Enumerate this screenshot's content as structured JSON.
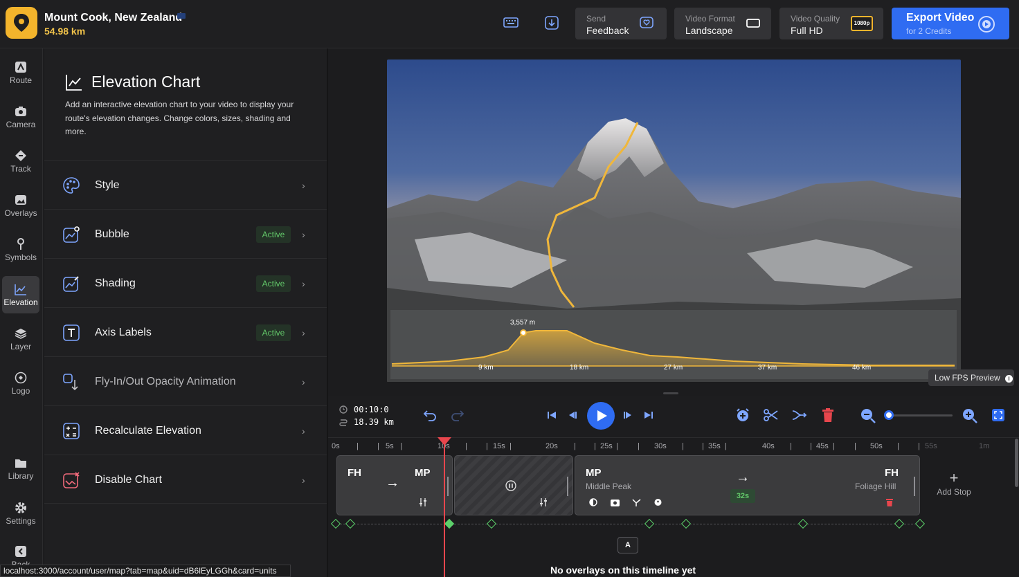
{
  "header": {
    "title": "Mount Cook, New Zealand",
    "distance": "54.98 km",
    "feedback": {
      "line1": "Send",
      "line2": "Feedback"
    },
    "format": {
      "line1": "Video Format",
      "line2": "Landscape"
    },
    "quality": {
      "line1": "Video Quality",
      "line2": "Full HD",
      "badge": "1080p"
    },
    "export": {
      "line1": "Export Video",
      "line2": "for 2 Credits"
    }
  },
  "nav": {
    "items": [
      {
        "label": "Route",
        "icon": "route-icon"
      },
      {
        "label": "Camera",
        "icon": "camera-icon"
      },
      {
        "label": "Track",
        "icon": "track-icon"
      },
      {
        "label": "Overlays",
        "icon": "overlays-icon"
      },
      {
        "label": "Symbols",
        "icon": "pin-icon"
      },
      {
        "label": "Elevation",
        "icon": "elevation-icon"
      },
      {
        "label": "Layer",
        "icon": "layers-icon"
      },
      {
        "label": "Logo",
        "icon": "logo-icon"
      },
      {
        "label": "Library",
        "icon": "folder-icon"
      },
      {
        "label": "Settings",
        "icon": "gear-icon"
      },
      {
        "label": "Back",
        "icon": "back-icon"
      }
    ]
  },
  "panel": {
    "title": "Elevation Chart",
    "description": "Add an interactive elevation chart to your video to display your route's elevation changes. Change colors, sizes, shading and more.",
    "rows": [
      {
        "label": "Style",
        "badge": "",
        "icon": "palette-icon"
      },
      {
        "label": "Bubble",
        "badge": "Active",
        "icon": "bubble-icon"
      },
      {
        "label": "Shading",
        "badge": "Active",
        "icon": "shading-icon"
      },
      {
        "label": "Axis Labels",
        "badge": "Active",
        "icon": "text-icon"
      },
      {
        "label": "Fly-In/Out Opacity Animation",
        "badge": "",
        "icon": "fly-in-icon"
      },
      {
        "label": "Recalculate Elevation",
        "badge": "",
        "icon": "calculator-icon"
      },
      {
        "label": "Disable Chart",
        "badge": "",
        "icon": "disable-chart-icon"
      }
    ]
  },
  "preview": {
    "peak_label": "3,557 m",
    "axis_labels": [
      "9 km",
      "18 km",
      "27 km",
      "37 km",
      "46 km"
    ],
    "fps_label": "Low FPS Preview"
  },
  "controls": {
    "time": "00:10:0",
    "distance": "18.39 km"
  },
  "ruler": [
    "0s",
    "5s",
    "10s",
    "15s",
    "20s",
    "25s",
    "30s",
    "35s",
    "40s",
    "45s",
    "50s",
    "55s",
    "1m"
  ],
  "timeline": {
    "clip1": {
      "from": "FH",
      "to": "MP"
    },
    "clip3": {
      "from": "MP",
      "from_name": "Middle Peak",
      "to": "FH",
      "to_name": "Foliage Hill",
      "duration": "32s"
    },
    "add_stop": "Add Stop",
    "no_overlays": "No overlays on this timeline yet",
    "overlay_marker": "A"
  },
  "status_url": "localhost:3000/account/user/map?tab=map&uid=dB6lEyLGGh&card=units"
}
